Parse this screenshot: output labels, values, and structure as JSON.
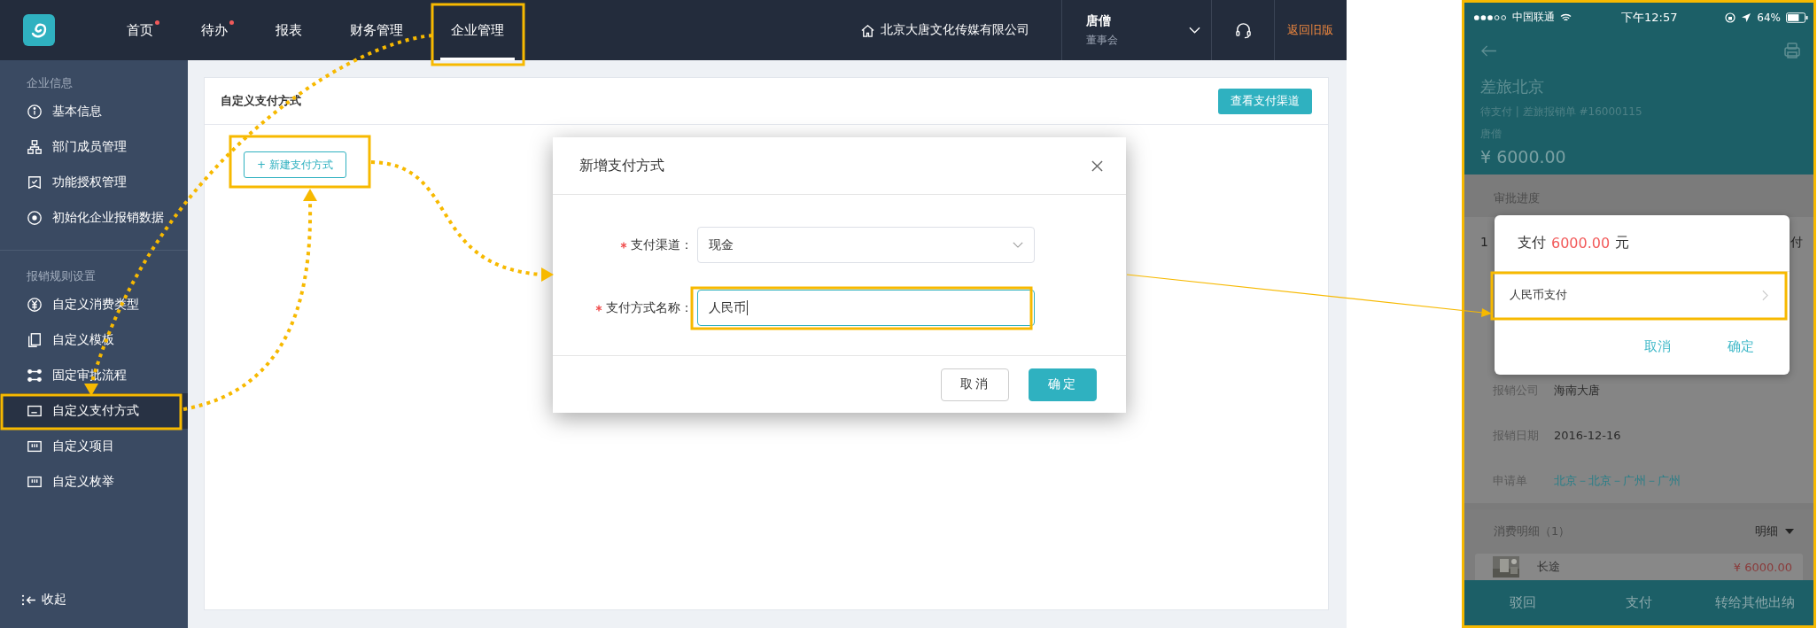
{
  "top_nav": {
    "nav_items": [
      {
        "label": "首页",
        "badge": true,
        "selected": false
      },
      {
        "label": "待办",
        "badge": true,
        "selected": false
      },
      {
        "label": "报表",
        "badge": false,
        "selected": false
      },
      {
        "label": "财务管理",
        "badge": false,
        "selected": false
      },
      {
        "label": "企业管理",
        "badge": false,
        "selected": true
      }
    ],
    "company": "北京大唐文化传媒有限公司",
    "user": {
      "name": "唐僧",
      "role": "董事会"
    },
    "old_version_link": "返回旧版"
  },
  "sidebar": {
    "sections": [
      {
        "title": "企业信息",
        "items": [
          {
            "label": "基本信息",
            "selected": false
          },
          {
            "label": "部门成员管理",
            "selected": false
          },
          {
            "label": "功能授权管理",
            "selected": false
          },
          {
            "label": "初始化企业报销数据",
            "selected": false
          }
        ]
      },
      {
        "title": "报销规则设置",
        "items": [
          {
            "label": "自定义消费类型",
            "selected": false
          },
          {
            "label": "自定义模板",
            "selected": false
          },
          {
            "label": "固定审批流程",
            "selected": false
          },
          {
            "label": "自定义支付方式",
            "selected": true
          },
          {
            "label": "自定义项目",
            "selected": false
          },
          {
            "label": "自定义枚举",
            "selected": false
          }
        ]
      }
    ],
    "collapse": "收起"
  },
  "page": {
    "title": "自定义支付方式",
    "view_channels_button": "查看支付渠道",
    "new_button": "+ 新建支付方式"
  },
  "dialog": {
    "title": "新增支付方式",
    "fields": [
      {
        "kind": "select",
        "label": "支付渠道：",
        "required": true,
        "value": "现金",
        "focused": false
      },
      {
        "kind": "input",
        "label": "支付方式名称：",
        "required": true,
        "value": "人民币",
        "focused": true
      }
    ],
    "buttons": [
      {
        "label": "取消",
        "primary": false
      },
      {
        "label": "确定",
        "primary": true
      }
    ]
  },
  "mobile": {
    "status_bar": {
      "carrier": "中国联通",
      "time": "下午12:57",
      "battery": "64%"
    },
    "header": {
      "title": "差旅北京",
      "subtitle": "待支付 | 差旅报销单 #16000115",
      "applicant": "唐僧",
      "amount": "¥ 6000.00"
    },
    "approval": {
      "title": "审批进度",
      "left_fragment": "1",
      "right_fragment": "付"
    },
    "details": [
      {
        "label": "报销公司",
        "value": "海南大唐",
        "kind": "text"
      },
      {
        "label": "报销日期",
        "value": "2016-12-16",
        "kind": "text"
      },
      {
        "label": "申请单",
        "value": "北京－北京－广州－广州",
        "kind": "link"
      }
    ],
    "expenses": {
      "title": "消费明细（1）",
      "toggle": "明细",
      "items": [
        {
          "name": "长途",
          "amount": "¥ 6000.00"
        }
      ]
    },
    "actions": [
      "驳回",
      "支付",
      "转给其他出纳"
    ],
    "pay_popup": {
      "prefix": "支付",
      "amount": "6000.00",
      "unit": "元",
      "options": [
        {
          "label": "人民币支付"
        }
      ],
      "buttons": [
        "取消",
        "确定"
      ]
    }
  }
}
